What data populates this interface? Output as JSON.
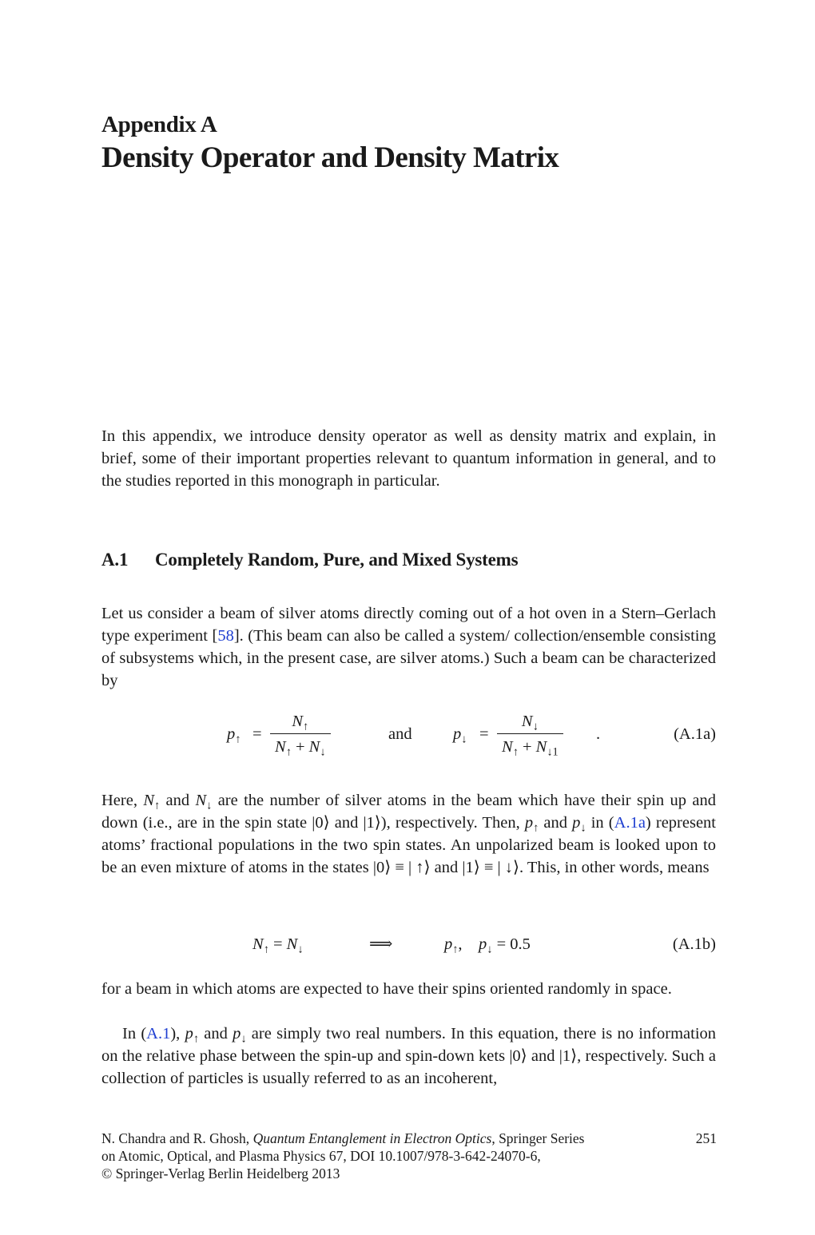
{
  "chapter": {
    "label": "Appendix A",
    "title": "Density Operator and Density Matrix"
  },
  "intro": "In this appendix, we introduce density operator as well as density matrix and explain, in brief, some of their important properties relevant to quantum information in general, and to the studies reported in this monograph in particular.",
  "section": {
    "number": "A.1",
    "title": "Completely Random, Pure, and Mixed Systems"
  },
  "para1": {
    "before_ref": "Let us consider a beam of silver atoms directly coming out of a hot oven in a Stern–Gerlach type experiment [",
    "ref": "58",
    "after_ref": "]. (This beam can also be called a system/ collection/ensemble consisting of subsystems which, in the present case, are silver atoms.) Such a beam can be characterized by"
  },
  "eq_a1a": {
    "lhs1": "p",
    "lhs1_sub": "↑",
    "num1": "N",
    "num1_sub": "↑",
    "den1_a": "N",
    "den1_a_sub": "↑",
    "den1_op": "+",
    "den1_b": "N",
    "den1_b_sub": "↓",
    "connector": "and",
    "lhs2": "p",
    "lhs2_sub": "↓",
    "num2": "N",
    "num2_sub": "↓",
    "den2_a": "N",
    "den2_a_sub": "↑",
    "den2_op": "+",
    "den2_b": "N",
    "den2_b_sub": "↓1",
    "equals": "=",
    "period": ".",
    "label": "(A.1a)"
  },
  "para2": {
    "t1": "Here, ",
    "t2": " and ",
    "t3": " are the number of silver atoms in the beam which have their spin up and down (i.e., are in the spin state |0⟩ and |1⟩), respectively. Then, ",
    "t4": " and ",
    "t5": " in (",
    "ref": "A.1a",
    "t6": ") represent atoms’ fractional populations in the two spin states. An unpolarized beam is looked upon to be an even mixture of atoms in the states |0⟩ ≡ | ↑⟩ and |1⟩ ≡ | ↓⟩. This, in other words, means",
    "N": "N",
    "p": "p",
    "up": "↑",
    "down": "↓"
  },
  "eq_a1b": {
    "N": "N",
    "p": "p",
    "up": "↑",
    "down": "↓",
    "equals": "=",
    "implies": "⟹",
    "comma": ",",
    "value": "= 0.5",
    "label": "(A.1b)"
  },
  "para3": {
    "text": "for a beam in which atoms are expected to have their spins oriented randomly in space."
  },
  "para4": {
    "t1": "In (",
    "ref": "A.1",
    "t2": "), ",
    "t3": " and ",
    "t4": " are simply two real numbers. In this equation, there is no information on the relative phase between the spin-up and spin-down kets |0⟩ and |1⟩, respectively. Such a collection of particles is usually referred to as an incoherent,",
    "p": "p",
    "up": "↑",
    "down": "↓"
  },
  "footer": {
    "authors": "N. Chandra and R. Ghosh, ",
    "book_title": "Quantum Entanglement in Electron Optics",
    "series": ", Springer Series",
    "line2": "on Atomic, Optical, and Plasma Physics 67, DOI 10.1007/978-3-642-24070-6,",
    "line3": "© Springer-Verlag Berlin Heidelberg 2013",
    "page_number": "251"
  },
  "colors": {
    "link": "#1f3fd1",
    "text": "#1a1a1a"
  }
}
